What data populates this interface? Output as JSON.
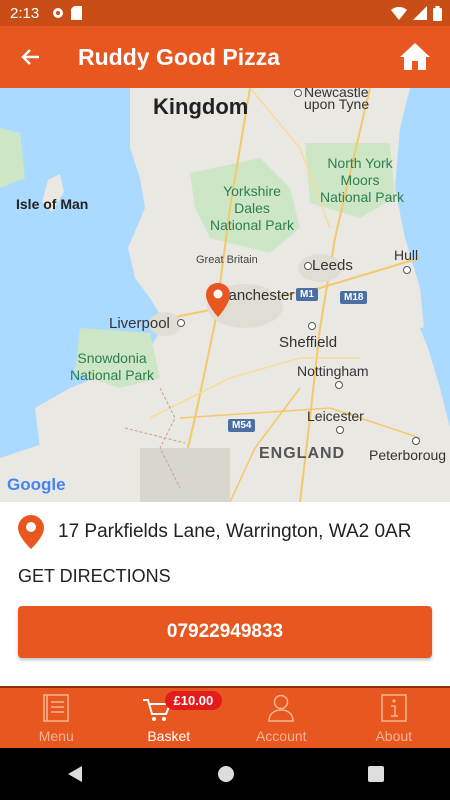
{
  "status_bar": {
    "time": "2:13"
  },
  "app_bar": {
    "title": "Ruddy Good Pizza"
  },
  "map": {
    "labels": {
      "kingdom": "Kingdom",
      "newcastle_1": "Newcastle",
      "newcastle_2": "upon Tyne",
      "isle_of_man": "Isle of Man",
      "north_york_1": "North York",
      "north_york_2": "Moors",
      "north_york_3": "National Park",
      "yorkshire_1": "Yorkshire",
      "yorkshire_2": "Dales",
      "yorkshire_3": "National Park",
      "hull": "Hull",
      "great_britain": "Great Britain",
      "leeds": "Leeds",
      "manchester": "Manchester",
      "liverpool": "Liverpool",
      "sheffield": "Sheffield",
      "snowdonia_1": "Snowdonia",
      "snowdonia_2": "National Park",
      "nottingham": "Nottingham",
      "leicester": "Leicester",
      "england": "ENGLAND",
      "peterborough": "Peterboroug",
      "m1": "M1",
      "m18": "M18",
      "m54": "M54"
    },
    "attribution": "Google"
  },
  "location": {
    "address": "17 Parkfields Lane, Warrington, WA2 0AR",
    "directions_label": "GET DIRECTIONS",
    "phone": "07922949833"
  },
  "bottom_nav": {
    "items": [
      {
        "label": "Menu"
      },
      {
        "label": "Basket"
      },
      {
        "label": "Account"
      },
      {
        "label": "About"
      }
    ],
    "basket_total": "£10.00"
  },
  "colors": {
    "brand": "#e8571f",
    "status_bar": "#c94d17",
    "badge": "#e31b1b"
  }
}
